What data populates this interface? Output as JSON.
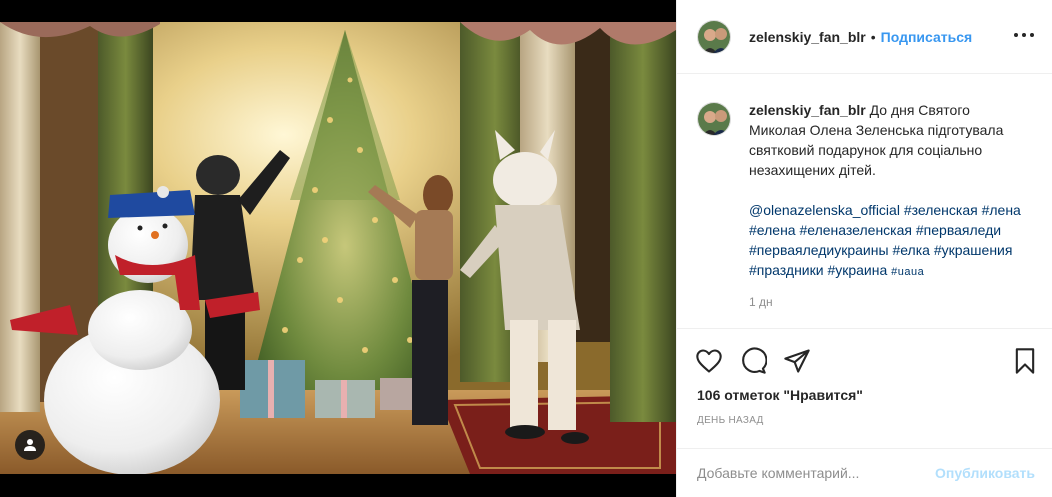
{
  "post": {
    "username": "zelenskiy_fan_blr",
    "separator": "•",
    "follow_label": "Подписаться",
    "more_label": "•••"
  },
  "caption": {
    "username": "zelenskiy_fan_blr",
    "text": "До дня Святого Миколая Олена Зеленська підготувала святковий подарунок для соціально незахищених дітей.",
    "hashtags": [
      "@olenazelenska_official",
      "#зеленская",
      "#лена",
      "#елена",
      "#еленазеленская",
      "#первая​леди",
      "#перваяледиукраины",
      "#елка",
      "#украшения",
      "#праздники",
      "#украина",
      "#uaua"
    ],
    "time_ago": "1 дн"
  },
  "actions": {
    "like_icon": "heart-icon",
    "comment_icon": "comment-bubble-icon",
    "share_icon": "paper-plane-icon",
    "save_icon": "bookmark-icon",
    "likes_text": "106 отметок \"Нравится\"",
    "posted_text": "ДЕНЬ НАЗАД"
  },
  "comment": {
    "placeholder": "Добавьте комментарий...",
    "publish_label": "Опубликовать"
  },
  "photo": {
    "user_tag_icon": "person-icon"
  },
  "colors": {
    "link_blue": "#3897f0",
    "hashtag_navy": "#00376b",
    "muted_gray": "#8e8e8e",
    "publish_disabled": "#b2dffc"
  }
}
